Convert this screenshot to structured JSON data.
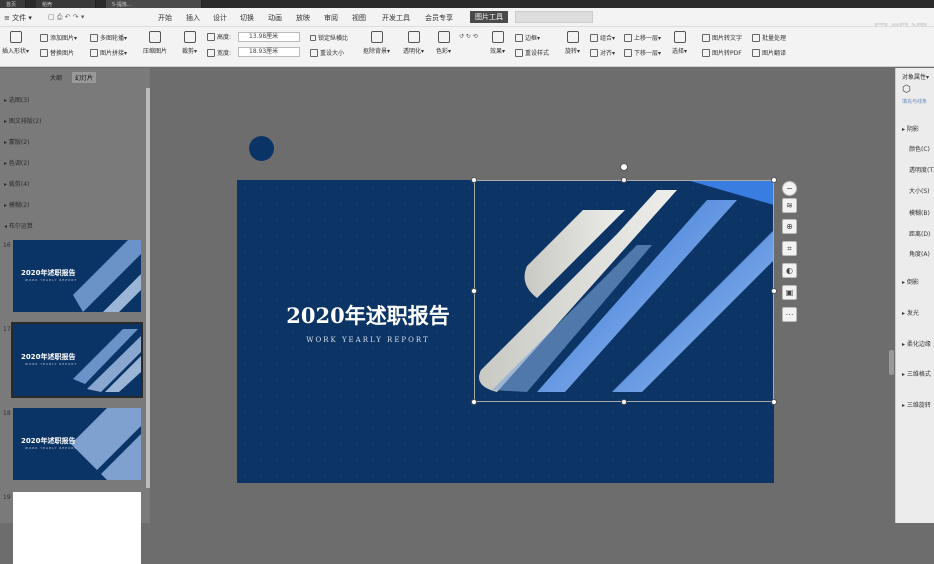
{
  "window": {
    "tabs": [
      "首页",
      "稻壳",
      "5-提炼…"
    ],
    "watermark": "吴明课"
  },
  "menubar": {
    "file_label": "≡ 文件 ▾",
    "items": [
      "开始",
      "插入",
      "设计",
      "切换",
      "动画",
      "放映",
      "审阅",
      "视图",
      "开发工具",
      "会员专享",
      "图片工具"
    ],
    "active": "图片工具"
  },
  "ribbon": {
    "insert_shape": "插入形状▾",
    "add_picture": "添加图片▾",
    "replace_picture": "替换图片",
    "multi_crop": "多图轮播▾",
    "picture_collage": "图片拼接▾",
    "compress": "压缩图片",
    "crop": "裁剪▾",
    "height_label": "高度:",
    "height_value": "13.98厘米",
    "width_label": "宽度:",
    "width_value": "18.93厘米",
    "lock_ratio": "锁定纵横比",
    "reset_size": "重设大小",
    "remove_bg": "抠除背景▾",
    "transparency": "透明化▾",
    "color": "色彩▾",
    "effects": "效果▾",
    "reset_style": "重设样式",
    "border": "边框▾",
    "rotate": "旋转▾",
    "group": "组合▾",
    "align": "对齐▾",
    "up_layer": "上移一层▾",
    "down_layer": "下移一层▾",
    "select": "选择▾",
    "img_to_text": "图片转文字",
    "img_to_pdf": "图片转PDF",
    "batch": "批量处理",
    "translate": "图片翻译"
  },
  "left_panel": {
    "tabs": [
      "大纲",
      "幻灯片"
    ],
    "selected_tab": "幻灯片",
    "sections": [
      "▸ 选图(3)",
      "▸ 图文排版(2)",
      "▸ 蒙版(2)",
      "▸ 色调(2)",
      "▸ 裁剪(4)",
      "▸ 模糊(2)",
      "◂ 布尔运算"
    ],
    "slides": [
      {
        "num": "16",
        "title": "2020年述职报告",
        "subtitle": "WORK YEARLY REPORT"
      },
      {
        "num": "17",
        "title": "2020年述职报告",
        "subtitle": "WORK YEARLY REPORT"
      },
      {
        "num": "18",
        "title": "2020年述职报告",
        "subtitle": "WORK YEARLY REPORT"
      },
      {
        "num": "19",
        "title": "",
        "subtitle": ""
      }
    ]
  },
  "slide": {
    "title": "2020年述职报告",
    "subtitle": "WORK YEARLY REPORT",
    "bg_color": "#0c3465"
  },
  "right_panel": {
    "header": "对象属性▾",
    "fill_tab": "填充与线条",
    "shadow_section": "▸ 阴影",
    "props": [
      "颜色(C)",
      "透明度(T)",
      "大小(S)",
      "模糊(B)",
      "距离(D)",
      "角度(A)"
    ],
    "sections": [
      "▸ 倒影",
      "▸ 发光",
      "▸ 柔化边缘",
      "▸ 三维格式",
      "▸ 三维旋转"
    ]
  },
  "colors": {
    "accent": "#0b3466",
    "ribbon_bg": "#f3f3f3",
    "active_tab": "#4a4a4a"
  }
}
